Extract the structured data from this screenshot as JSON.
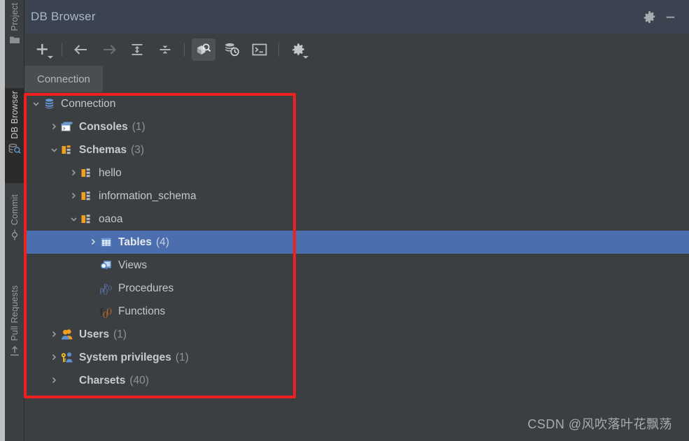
{
  "window": {
    "title": "DB Browser",
    "settings_icon": "gear-icon",
    "minimize_icon": "minimize-icon"
  },
  "left_stripe": {
    "tabs": [
      {
        "label": "Project",
        "icon": "folder-icon",
        "active": false
      },
      {
        "label": "DB Browser",
        "icon": "database-search-icon",
        "active": true
      },
      {
        "label": "Commit",
        "icon": "commit-icon",
        "active": false
      },
      {
        "label": "Pull Requests",
        "icon": "pull-request-icon",
        "active": false
      }
    ]
  },
  "toolbar": {
    "buttons": [
      {
        "name": "add-button",
        "tooltip": "New",
        "icon": "plus-icon",
        "has_dropdown": true,
        "pressed": false
      },
      {
        "name": "back-button",
        "tooltip": "Back",
        "icon": "arrow-left-icon",
        "has_dropdown": false,
        "pressed": false
      },
      {
        "name": "forward-button",
        "tooltip": "Forward",
        "icon": "arrow-right-icon",
        "has_dropdown": false,
        "pressed": false
      },
      {
        "name": "expand-all-button",
        "tooltip": "Expand All",
        "icon": "expand-all-icon",
        "has_dropdown": false,
        "pressed": false
      },
      {
        "name": "collapse-all-button",
        "tooltip": "Collapse All",
        "icon": "collapse-all-icon",
        "has_dropdown": false,
        "pressed": false
      },
      {
        "name": "object-filter-button",
        "tooltip": "Show Object Filter",
        "icon": "box-search-icon",
        "has_dropdown": false,
        "pressed": true
      },
      {
        "name": "db-history-button",
        "tooltip": "Database History",
        "icon": "database-clock-icon",
        "has_dropdown": false,
        "pressed": false
      },
      {
        "name": "console-button",
        "tooltip": "Open Console",
        "icon": "terminal-icon",
        "has_dropdown": false,
        "pressed": false
      },
      {
        "name": "settings-button",
        "tooltip": "Settings",
        "icon": "gear-icon",
        "has_dropdown": true,
        "pressed": false
      }
    ]
  },
  "tabs": {
    "items": [
      {
        "label": "Connection",
        "active": true
      }
    ]
  },
  "tree": {
    "rows": [
      {
        "label": "Connection",
        "count": "",
        "icon": "database-icon",
        "indent": 0,
        "arrow": "down",
        "bold": false,
        "selected": false
      },
      {
        "label": "Consoles",
        "count": "(1)",
        "icon": "console-window-icon",
        "indent": 1,
        "arrow": "right",
        "bold": true,
        "selected": false
      },
      {
        "label": "Schemas",
        "count": "(3)",
        "icon": "schema-icon",
        "indent": 1,
        "arrow": "down",
        "bold": true,
        "selected": false
      },
      {
        "label": "hello",
        "count": "",
        "icon": "schema-icon",
        "indent": 2,
        "arrow": "right",
        "bold": false,
        "selected": false
      },
      {
        "label": "information_schema",
        "count": "",
        "icon": "schema-icon",
        "indent": 2,
        "arrow": "right",
        "bold": false,
        "selected": false
      },
      {
        "label": "oaoa",
        "count": "",
        "icon": "schema-icon",
        "indent": 2,
        "arrow": "down",
        "bold": false,
        "selected": false
      },
      {
        "label": "Tables",
        "count": "(4)",
        "icon": "table-icon",
        "indent": 3,
        "arrow": "right",
        "bold": true,
        "selected": true
      },
      {
        "label": "Views",
        "count": "",
        "icon": "view-icon",
        "indent": 3,
        "arrow": "none",
        "bold": false,
        "selected": false
      },
      {
        "label": "Procedures",
        "count": "",
        "icon": "procedure-icon",
        "indent": 3,
        "arrow": "none",
        "bold": false,
        "selected": false
      },
      {
        "label": "Functions",
        "count": "",
        "icon": "function-icon",
        "indent": 3,
        "arrow": "none",
        "bold": false,
        "selected": false
      },
      {
        "label": "Users",
        "count": "(1)",
        "icon": "users-icon",
        "indent": 1,
        "arrow": "right",
        "bold": true,
        "selected": false
      },
      {
        "label": "System privileges",
        "count": "(1)",
        "icon": "key-privileges-icon",
        "indent": 1,
        "arrow": "right",
        "bold": true,
        "selected": false
      },
      {
        "label": "Charsets",
        "count": "(40)",
        "icon": "none",
        "indent": 1,
        "arrow": "right",
        "bold": true,
        "selected": false
      }
    ]
  },
  "annotation": {
    "color": "#f02020",
    "shape": "rectangle"
  },
  "watermark": {
    "text": "CSDN @风吹落叶花飘荡"
  },
  "colors": {
    "window_bg": "#3c3f41",
    "titlebar_bg": "#3c4350",
    "selection": "#4b6eaf",
    "text": "#bbbbbb",
    "accent_red": "#f02020",
    "schema_orange": "#f0a020",
    "icon_blue": "#4b8ed8"
  }
}
